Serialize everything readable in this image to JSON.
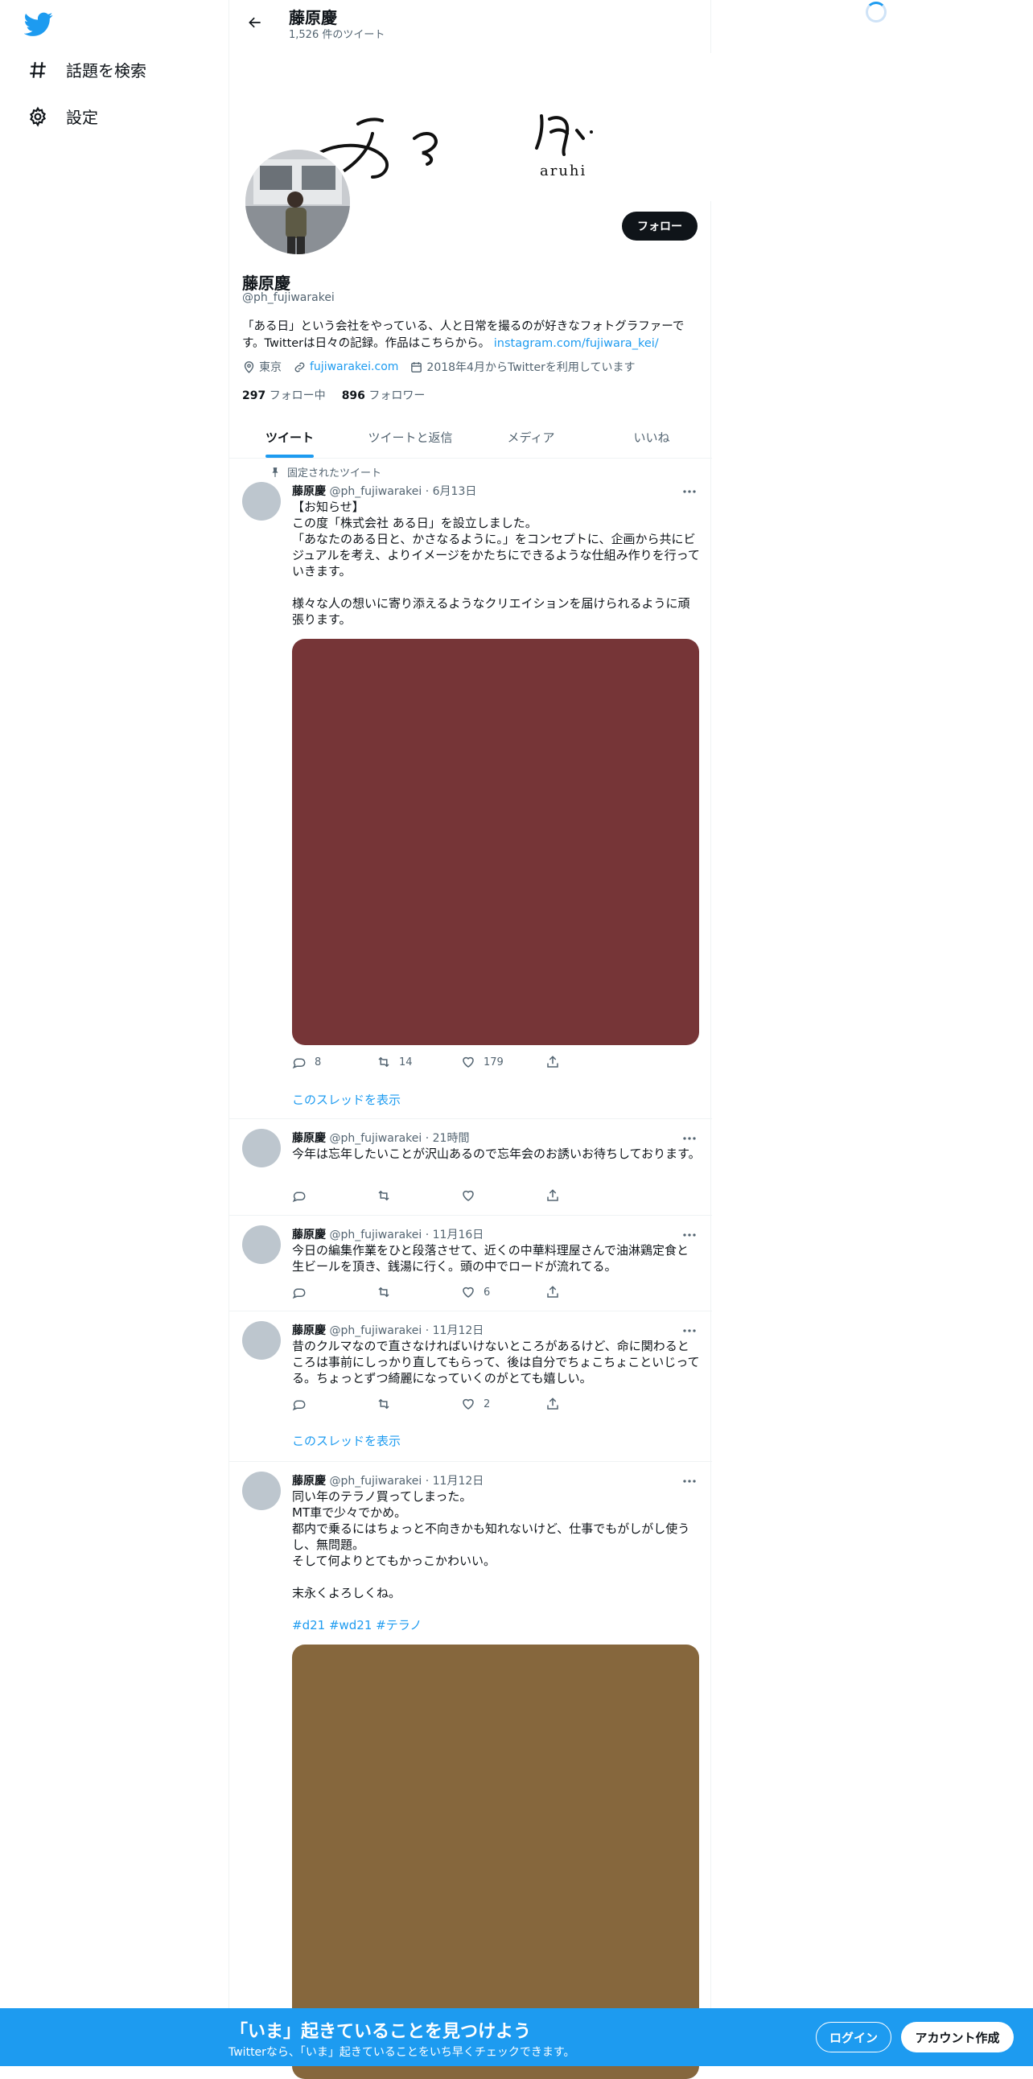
{
  "nav": {
    "logo_icon": "twitter-bird-icon",
    "items": [
      {
        "label": "話題を検索",
        "icon": "hashtag-icon"
      },
      {
        "label": "設定",
        "icon": "gear-icon"
      }
    ]
  },
  "header": {
    "title": "藤原慶",
    "tweet_count": "1,526 件のツイート"
  },
  "banner": {
    "logo_text": "aruhi"
  },
  "profile": {
    "name": "藤原慶",
    "handle": "@ph_fujiwarakei",
    "follow_label": "フォロー",
    "bio_text": "「ある日」という会社をやっている、人と日常を撮るのが好きなフォトグラファーです。Twitterは日々の記録。作品はこちらから。",
    "bio_link": "instagram.com/fujiwara_kei/",
    "location": "東京",
    "website": "fujiwarakei.com",
    "joined": "2018年4月からTwitterを利用しています",
    "following_count": "297",
    "following_label": "フォロー中",
    "followers_count": "896",
    "followers_label": "フォロワー"
  },
  "tabs": [
    {
      "label": "ツイート",
      "active": true
    },
    {
      "label": "ツイートと返信",
      "active": false
    },
    {
      "label": "メディア",
      "active": false
    },
    {
      "label": "いいね",
      "active": false
    }
  ],
  "pinned_label": "固定されたツイート",
  "show_thread_label": "このスレッドを表示",
  "tweets": [
    {
      "name": "藤原慶",
      "handle": "@ph_fujiwarakei",
      "time": "6月13日",
      "text": "【お知らせ】\nこの度「株式会社 ある日」を設立しました。\n「あなたのある日と、かさなるように。」をコンセプトに、企画から共にビジュアルを考え、よりイメージをかたちにできるような仕組み作りを行っていきます。\n\n様々な人の想いに寄り添えるようなクリエイションを届けられるように頑張ります。",
      "media_color": "#763537",
      "replies": "8",
      "retweets": "14",
      "likes": "179"
    },
    {
      "name": "藤原慶",
      "handle": "@ph_fujiwarakei",
      "time": "21時間",
      "text": "今年は忘年したいことが沢山あるので忘年会のお誘いお待ちしております。",
      "replies": "",
      "retweets": "",
      "likes": ""
    },
    {
      "name": "藤原慶",
      "handle": "@ph_fujiwarakei",
      "time": "11月16日",
      "text": "今日の編集作業をひと段落させて、近くの中華料理屋さんで油淋鶏定食と生ビールを頂き、銭湯に行く。頭の中でロードが流れてる。",
      "replies": "",
      "retweets": "",
      "likes": "6"
    },
    {
      "name": "藤原慶",
      "handle": "@ph_fujiwarakei",
      "time": "11月12日",
      "text": "昔のクルマなので直さなければいけないところがあるけど、命に関わるところは事前にしっかり直してもらって、後は自分でちょこちょこといじってる。ちょっとずつ綺麗になっていくのがとても嬉しい。",
      "replies": "",
      "retweets": "",
      "likes": "2"
    },
    {
      "name": "藤原慶",
      "handle": "@ph_fujiwarakei",
      "time": "11月12日",
      "text": "同い年のテラノ買ってしまった。\nMT車で少々でかめ。\n都内で乗るにはちょっと不向きかも知れないけど、仕事でもがしがし使うし、無問題。\nそして何よりとてもかっこかわいい。\n\n末永くよろしくね。",
      "hashtags": "#d21 #wd21 #テラノ",
      "media_color": "#86673d"
    }
  ],
  "bottom_bar": {
    "title": "「いま」起きていることを見つけよう",
    "subtitle": "Twitterなら、「いま」起きていることをいち早くチェックできます。",
    "login_label": "ログイン",
    "signup_label": "アカウント作成"
  }
}
